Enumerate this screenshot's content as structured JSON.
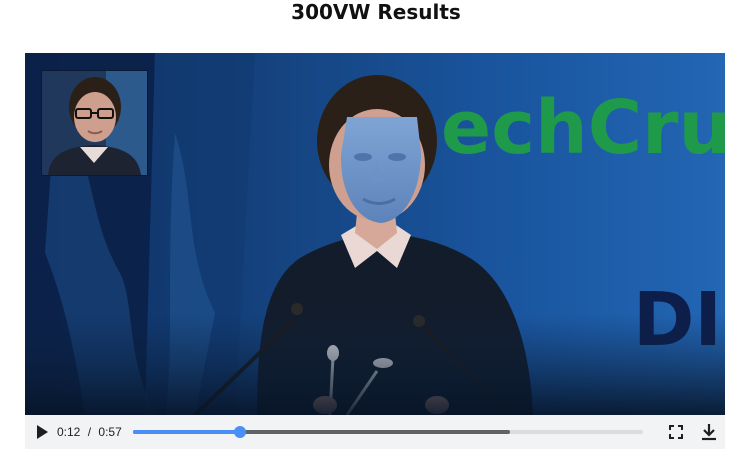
{
  "page": {
    "title": "300VW Results"
  },
  "video": {
    "background_text_top": "echCru",
    "background_text_side": "DIS",
    "thumbnail": "inset-face-thumbnail",
    "overlay": "3d-face-mesh-overlay"
  },
  "player": {
    "current_time": "0:12",
    "separator": "/",
    "duration": "0:57",
    "played_fraction": 0.21,
    "buffered_fraction": 0.74,
    "icons": {
      "play": "play-icon",
      "fullscreen": "fullscreen-icon",
      "download": "download-icon"
    }
  },
  "colors": {
    "accent": "#4a8ff5",
    "stage_blue": "#1b4f97",
    "logo_green": "#1f9a4b",
    "logo_navy": "#0d1e4a"
  }
}
